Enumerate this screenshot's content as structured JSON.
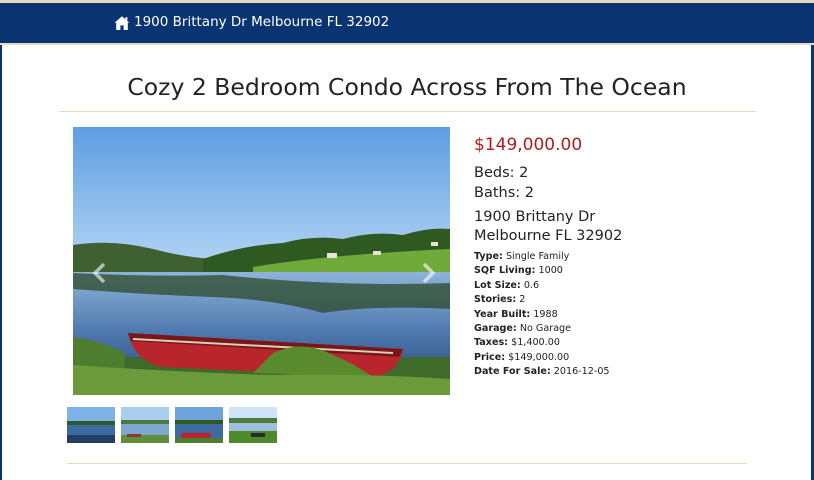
{
  "header": {
    "home_icon": "home-icon",
    "address": "1900 Brittany Dr Melbourne FL 32902"
  },
  "listing": {
    "title": "Cozy 2 Bedroom Condo Across From The Ocean",
    "price": "$149,000.00",
    "beds": "Beds: 2",
    "baths": "Baths: 2",
    "address_line1": "1900 Brittany Dr",
    "address_line2": "Melbourne FL 32902"
  },
  "facts": [
    {
      "label": "Type:",
      "value": "Single Family"
    },
    {
      "label": "SQF Living:",
      "value": "1000"
    },
    {
      "label": "Lot Size:",
      "value": "0.6"
    },
    {
      "label": "Stories:",
      "value": "2"
    },
    {
      "label": "Year Built:",
      "value": "1988"
    },
    {
      "label": "Garage:",
      "value": "No Garage"
    },
    {
      "label": "Taxes:",
      "value": "$1,400.00"
    },
    {
      "label": "Price:",
      "value": "$149,000.00"
    },
    {
      "label": "Date For Sale:",
      "value": "2016-12-05"
    }
  ],
  "gallery": {
    "prev_icon": "chevron-left-icon",
    "next_icon": "chevron-right-icon",
    "thumbnail_count": 4
  },
  "colors": {
    "header_bg": "#0a3372",
    "price": "#b01c1c",
    "rule": "#e3dab9"
  }
}
